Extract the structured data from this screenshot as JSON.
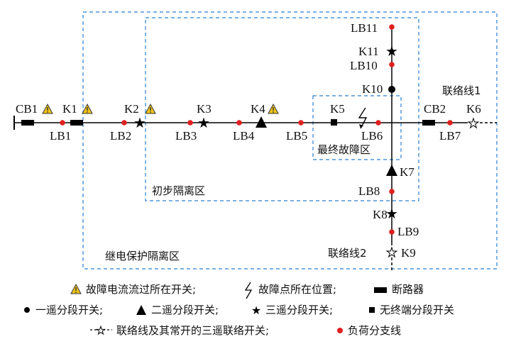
{
  "zones": {
    "relay": "继电保护隔离区",
    "prelim": "初步隔离区",
    "final": "最终故障区"
  },
  "tie_lines": {
    "tie1": "联络线1",
    "tie2": "联络线2"
  },
  "labels": {
    "CB1": "CB1",
    "K1": "K1",
    "LB1": "LB1",
    "K2": "K2",
    "LB2": "LB2",
    "K3": "K3",
    "LB3": "LB3",
    "K4": "K4",
    "LB4": "LB4",
    "LB5": "LB5",
    "K5": "K5",
    "LB6": "LB6",
    "CB2": "CB2",
    "K6": "K6",
    "LB7": "LB7",
    "LB11": "LB11",
    "K11": "K11",
    "LB10": "LB10",
    "K10": "K10",
    "K7": "K7",
    "LB8": "LB8",
    "K8": "K8",
    "LB9": "LB9",
    "K9": "K9"
  },
  "legend": {
    "fault_current": "故障电流流过所在开关;",
    "fault_point": "故障点所在位置;",
    "breaker": "断路器",
    "one_remote": "一遥分段开关;",
    "two_remote": "二遥分段开关;",
    "three_remote": "三遥分段开关;",
    "no_terminal": "无终端分段开关",
    "tie_switch": "联络线及其常开的三遥联络开关;",
    "load_branch": "负荷分支线"
  },
  "colors": {
    "zone_border": "#2a7fd0",
    "load_dot": "#e02020",
    "warning_fill": "#f0c419"
  }
}
